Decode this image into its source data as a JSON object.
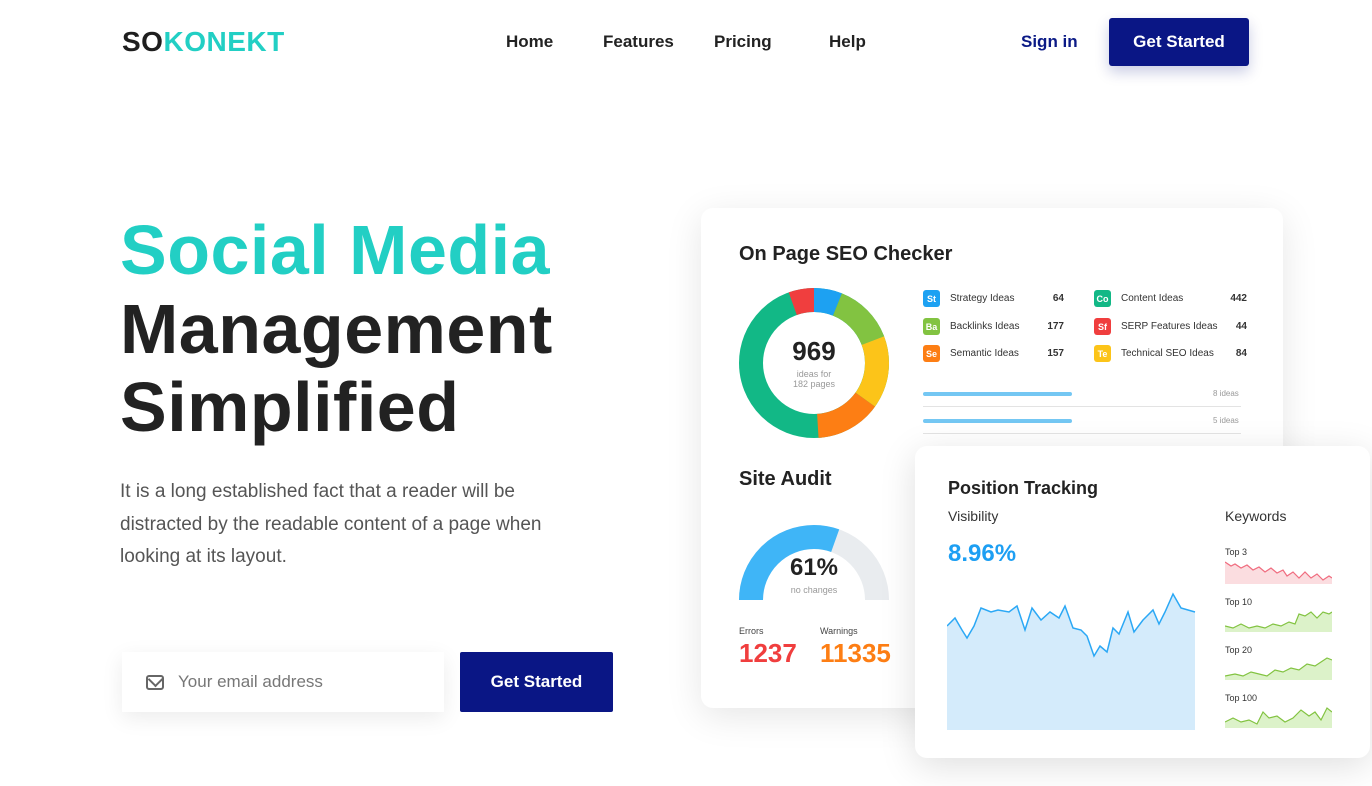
{
  "nav": {
    "logo_part1": "SO",
    "logo_part2": "KONEKT",
    "links": [
      "Home",
      "Features",
      "Pricing",
      "Help"
    ],
    "signin": "Sign in",
    "cta": "Get Started"
  },
  "hero": {
    "line1": "Social Media",
    "line2": "Management",
    "line3": "Simplified",
    "description": "It is a long established fact that a reader will be distracted by the readable content of a page when looking at its layout.",
    "email_placeholder": "Your email address",
    "cta": "Get Started"
  },
  "seo": {
    "title": "On Page SEO Checker",
    "total": "969",
    "total_sub": "ideas for",
    "total_sub2": "182 pages",
    "ideas": [
      {
        "badge": "St",
        "label": "Strategy Ideas",
        "value": "64",
        "color": "#1da1f2"
      },
      {
        "badge": "Co",
        "label": "Content Ideas",
        "value": "442",
        "color": "#12b886"
      },
      {
        "badge": "Ba",
        "label": "Backlinks Ideas",
        "value": "177",
        "color": "#82c341"
      },
      {
        "badge": "Sf",
        "label": "SERP Features Ideas",
        "value": "44",
        "color": "#f03e3e"
      },
      {
        "badge": "Se",
        "label": "Semantic Ideas",
        "value": "157",
        "color": "#fd7e14"
      },
      {
        "badge": "Te",
        "label": "Technical SEO Ideas",
        "value": "84",
        "color": "#fcc419"
      }
    ],
    "bars": [
      {
        "label": "8 ideas",
        "fraction": 0.78
      },
      {
        "label": "5 ideas",
        "fraction": 0.78
      }
    ]
  },
  "audit": {
    "title": "Site Audit",
    "percent": "61%",
    "percent_value": 61,
    "sub": "no changes",
    "errors_label": "Errors",
    "errors_value": "1237",
    "warnings_label": "Warnings",
    "warnings_value": "11335"
  },
  "tracking": {
    "title": "Position Tracking",
    "visibility_label": "Visibility",
    "visibility_value": "8.96%",
    "keywords_label": "Keywords",
    "keywords": [
      "Top 3",
      "Top 10",
      "Top 20",
      "Top 100"
    ]
  },
  "colors": {
    "teal": "#22cfc4",
    "navy": "#0a1685",
    "blue": "#1d9ff3",
    "error": "#f03e3e",
    "warning": "#fd7e14"
  }
}
